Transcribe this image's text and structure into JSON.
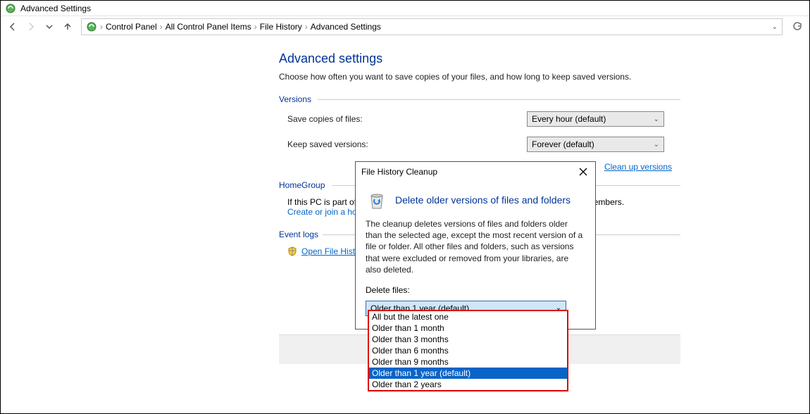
{
  "window": {
    "title": "Advanced Settings"
  },
  "breadcrumb": {
    "items": [
      "Control Panel",
      "All Control Panel Items",
      "File History",
      "Advanced Settings"
    ]
  },
  "page": {
    "title": "Advanced settings",
    "subtitle": "Choose how often you want to save copies of your files, and how long to keep saved versions."
  },
  "sections": {
    "versions": {
      "label": "Versions",
      "save_label": "Save copies of files:",
      "save_value": "Every hour (default)",
      "keep_label": "Keep saved versions:",
      "keep_value": "Forever (default)",
      "cleanup_link": "Clean up versions"
    },
    "homegroup": {
      "label": "HomeGroup",
      "line1": "If this PC is part of",
      "line2_suffix": "members.",
      "link": "Create or join a ho"
    },
    "eventlogs": {
      "label": "Event logs",
      "link": "Open File Hist"
    }
  },
  "dialog": {
    "title": "File History Cleanup",
    "heading": "Delete older versions of files and folders",
    "description": "The cleanup deletes versions of files and folders older than the selected age, except the most recent version of a file or folder. All other files and folders, such as versions that were excluded or removed from your libraries, are also deleted.",
    "delete_label": "Delete files:",
    "selected": "Older than 1 year (default)",
    "options": [
      "All but the latest one",
      "Older than 1 month",
      "Older than 3 months",
      "Older than 6 months",
      "Older than 9 months",
      "Older than 1 year (default)",
      "Older than 2 years"
    ]
  }
}
